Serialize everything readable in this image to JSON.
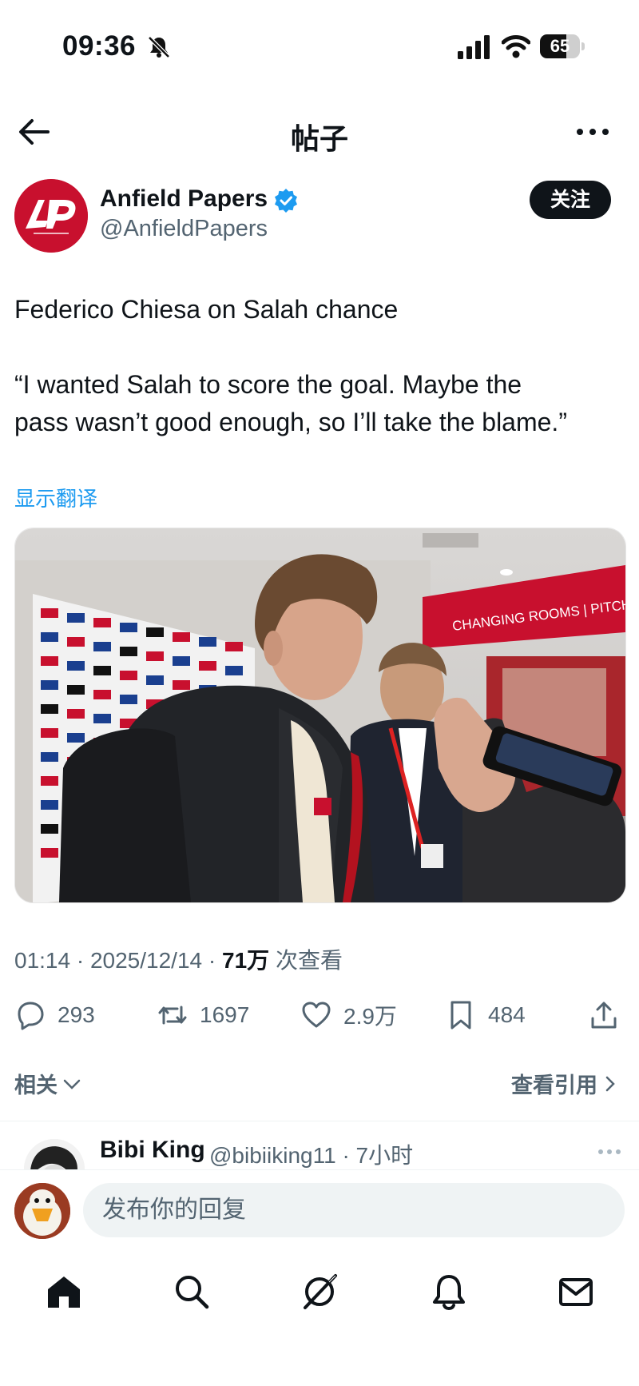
{
  "status_bar": {
    "time": "09:36",
    "battery": 65
  },
  "header": {
    "title": "帖子"
  },
  "post": {
    "author_name": "Anfield Papers",
    "author_handle": "@AnfieldPapers",
    "follow_label": "关注",
    "lines": [
      "Federico Chiesa on Salah chance",
      "“I wanted Salah to score the goal. Maybe the",
      "pass wasn’t good enough, so I’ll take the blame.”"
    ],
    "translate_label": "显示翻译",
    "media_sign_text": "CHANGING ROOMS | PITCH AC",
    "time": "01:14",
    "date": "2025/12/14",
    "views": "71万",
    "views_suffix": "次查看",
    "stats": {
      "replies": "293",
      "reposts": "1697",
      "likes": "2.9万",
      "bookmarks": "484"
    },
    "related_label": "相关",
    "quotes_label": "查看引用"
  },
  "reply_preview": {
    "name": "Bibi King",
    "handle_time": "@bibiiking11 · 7小时"
  },
  "composer": {
    "placeholder": "发布你的回复"
  },
  "tabs": [
    "home-icon",
    "search-icon",
    "grok-icon",
    "notifications-icon",
    "messages-icon"
  ],
  "colors": {
    "accent": "#1d9bf0",
    "brand_red": "#c8102e",
    "text": "#0f1419",
    "muted": "#536471"
  }
}
